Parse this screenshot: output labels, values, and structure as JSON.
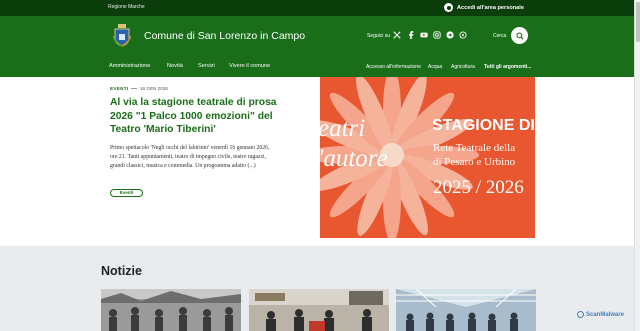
{
  "topbar": {
    "region": "Regione Marche",
    "login": "Accedi all'area personale"
  },
  "header": {
    "title": "Comune di San Lorenzo in Campo",
    "follow": "Seguici su",
    "search_label": "Cerca",
    "social_icons": [
      "x-icon",
      "facebook-icon",
      "youtube-icon",
      "instagram-icon",
      "telegram-icon",
      "whatsapp-icon"
    ]
  },
  "nav": {
    "main": [
      "Amministrazione",
      "Novità",
      "Servizi",
      "Vivere il comune"
    ],
    "sub": [
      "Accesso all'informazione",
      "Acqua",
      "Agricoltura",
      "Tutti gli argomenti..."
    ]
  },
  "hero": {
    "category": "EVENTI",
    "date": "16 GEN 2026",
    "title": "Al via la stagione teatrale di prosa 2026 \"1 Palco 1000 emozioni\" del Teatro 'Mario Tiberini'",
    "text": "Primo spettacolo 'Negli occhi del labirinto' venerdì 16 gennaio 2026, ore 21. Tanti appuntamenti, teatro di impegno civile, teatro ragazzi, grandi classici, musica e commedia. Un programma adatto (...)",
    "tag": "Eventi"
  },
  "poster": {
    "word1": "eatri",
    "word2": "'autore",
    "title": "STAGIONE DI",
    "sub1": "Rete Teatrale della",
    "sub2": "di Pesaro e Urbino",
    "year": "2025 / 2026"
  },
  "news": {
    "heading": "Notizie"
  },
  "watermark": "ScanMalware",
  "colors": {
    "primary": "#1a6e1a",
    "dark": "#0b3d0b",
    "poster": "#e8572f"
  }
}
